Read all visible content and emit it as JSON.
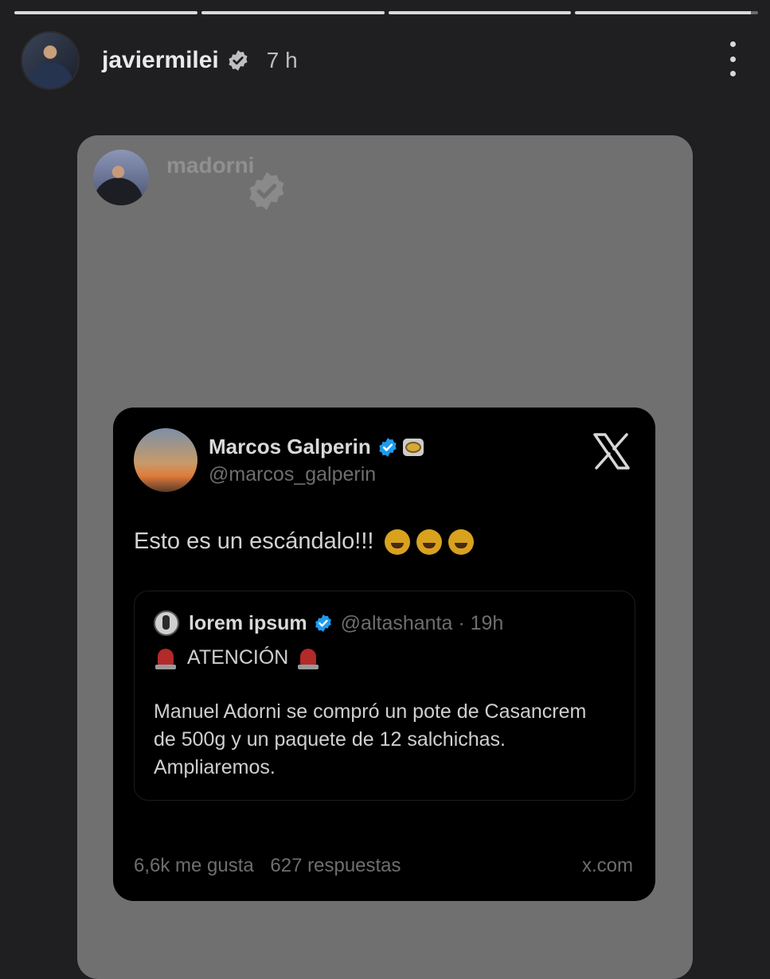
{
  "story": {
    "progress": {
      "segments_total": 4,
      "completed": 3,
      "current_fraction": 0.96
    },
    "user": {
      "name": "javiermilei",
      "time": "7 h"
    }
  },
  "shared_post": {
    "user": "madorni"
  },
  "tweet": {
    "name": "Marcos Galperin",
    "handle": "@marcos_galperin",
    "text": "Esto es un escándalo!!!",
    "quote": {
      "name": "lorem ipsum",
      "meta": "@altashanta · 19h",
      "headline": "ATENCIÓN",
      "body": "Manuel Adorni se compró un pote de Casancrem de 500g y un paquete de 12 salchichas. Ampliaremos."
    },
    "likes": "6,6k me gusta",
    "replies": "627 respuestas",
    "source": "x.com"
  },
  "colors": {
    "background": "#1f1f21",
    "card": "#707070",
    "tweet_bg": "#000000",
    "verified_blue": "#1d9bf0"
  },
  "icons": [
    "verified-badge-icon",
    "more-options-icon",
    "x-logo-icon",
    "laugh-emoji-icon",
    "siren-emoji-icon"
  ]
}
